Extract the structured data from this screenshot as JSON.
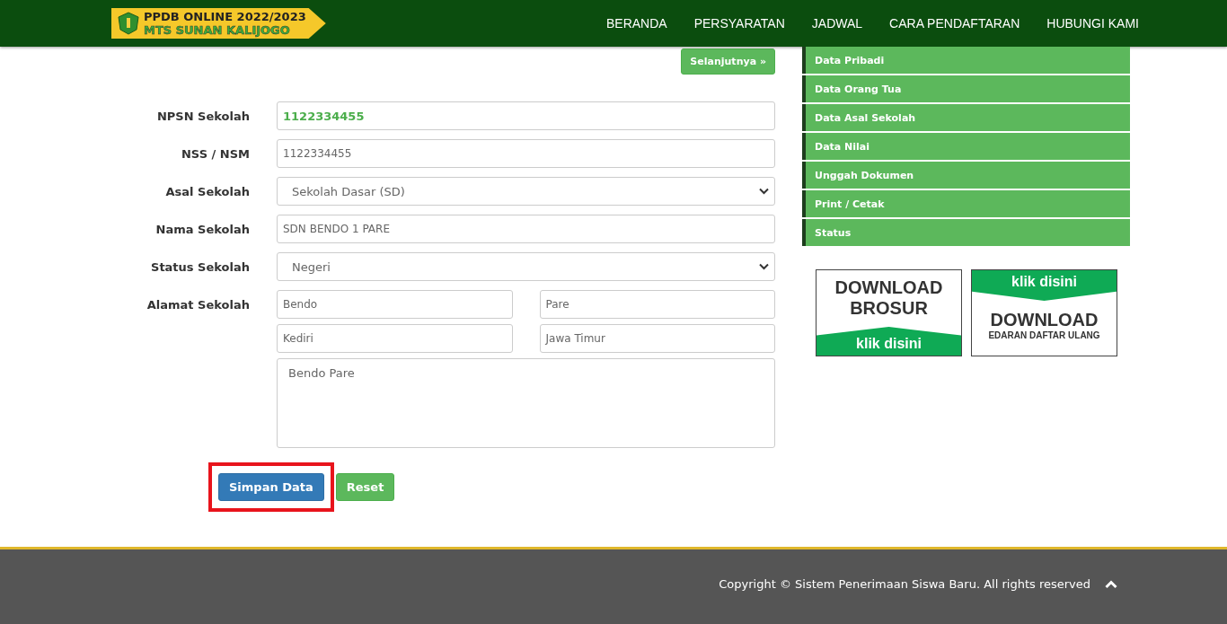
{
  "navbar": {
    "logo": {
      "line_1": "PPDB ONLINE 2022/2023",
      "line_2": "MTS SUNAN KALIJOGO"
    },
    "menu": [
      "BERANDA",
      "PERSYARATAN",
      "JADWAL",
      "CARA PENDAFTARAN",
      "HUBUNGI KAMI"
    ]
  },
  "next_button": "Selanjutnya »",
  "form": [
    {
      "kind": "input",
      "label": "NPSN Sekolah",
      "values": [
        "1122334455"
      ],
      "emphasis": true
    },
    {
      "kind": "input",
      "label": "NSS / NSM",
      "values": [
        "1122334455"
      ],
      "emphasis": false
    },
    {
      "kind": "select",
      "label": "Asal Sekolah",
      "values": [
        "Sekolah Dasar (SD)"
      ]
    },
    {
      "kind": "input",
      "label": "Nama Sekolah",
      "values": [
        "SDN BENDO 1 PARE"
      ],
      "emphasis": false
    },
    {
      "kind": "select",
      "label": "Status Sekolah",
      "values": [
        "Negeri"
      ]
    },
    {
      "kind": "address",
      "label": "Alamat Sekolah",
      "values": [
        "Bendo",
        "Pare",
        "Kediri",
        "Jawa Timur"
      ],
      "textarea": "Bendo Pare"
    }
  ],
  "buttons": [
    {
      "kind": "primary",
      "label": "Simpan Data",
      "highlighted": true
    },
    {
      "kind": "success",
      "label": "Reset",
      "highlighted": false
    }
  ],
  "sidebar": {
    "items": [
      "Data Pribadi",
      "Data Orang Tua",
      "Data Asal Sekolah",
      "Data Nilai",
      "Unggah Dokumen",
      "Print / Cetak",
      "Status"
    ]
  },
  "banners": [
    {
      "kind": "bottom",
      "title": "DOWNLOAD BROSUR",
      "action": "klik disini"
    },
    {
      "kind": "top",
      "action": "klik disini",
      "title": "DOWNLOAD",
      "subtitle": "EDARAN DAFTAR ULANG"
    }
  ],
  "footer": {
    "copyright": "Copyright © Sistem Penerimaan Siswa Baru. All rights reserved"
  }
}
